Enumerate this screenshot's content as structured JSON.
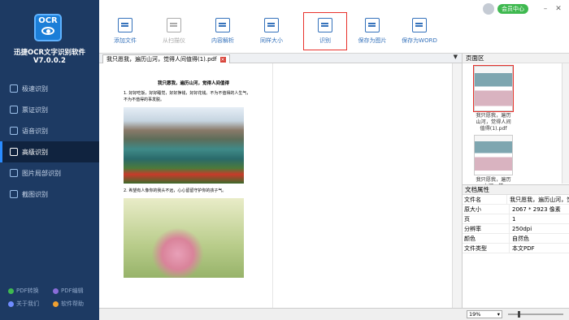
{
  "app": {
    "logo_text": "OCR",
    "title": "迅捷OCR文字识别软件V7.0.0.2"
  },
  "sidebar": {
    "items": [
      {
        "label": "极速识别",
        "active": false
      },
      {
        "label": "票证识别",
        "active": false
      },
      {
        "label": "语音识别",
        "active": false
      },
      {
        "label": "高级识别",
        "active": true
      },
      {
        "label": "图片局部识别",
        "active": false
      },
      {
        "label": "截图识别",
        "active": false
      }
    ],
    "bottom": [
      "PDF转换",
      "PDF编辑",
      "关于我们",
      "软件帮助"
    ]
  },
  "topright": {
    "vip_label": "会员中心",
    "minimize": "–",
    "close": "✕"
  },
  "toolbar": {
    "add_file": "添加文件",
    "scanner": "从扫描仪",
    "content_parse": "内容解析",
    "same_size": "同样大小",
    "recognize": "识别",
    "save_image": "保存为图片",
    "save_word": "保存为WORD"
  },
  "tab": {
    "label": "我只愿我，遍历山河，觉得人间值得(1).pdf"
  },
  "document": {
    "title": "我只愿我，遍历山河，觉得人间值得",
    "line1": "1.  好好吃饭，好好睡觉，好好挣钱，好好花钱。不为不值得的人生气，不为不值得的事发脱。",
    "line2": "2.  希望有人像你的我头不远，心心留留守护你的孩子气。"
  },
  "pages_panel": {
    "title": "页面区",
    "thumb_caption": "我只愿我，遍历山河，觉得人间值得(1).pdf",
    "thumb_caption2": "我只愿我，遍历山河，觉"
  },
  "props": {
    "title": "文档属性",
    "rows": [
      {
        "k": "文件名",
        "v": "我只愿我，遍历山河，觉"
      },
      {
        "k": "原大小",
        "v": "2067 * 2923 像素"
      },
      {
        "k": "页",
        "v": "1"
      },
      {
        "k": "分辨率",
        "v": "250dpi"
      },
      {
        "k": "颜色",
        "v": "自然色"
      },
      {
        "k": "文件类型",
        "v": "本文PDF"
      }
    ]
  },
  "status": {
    "zoom": "19%",
    "zoom_level": 0.19
  }
}
